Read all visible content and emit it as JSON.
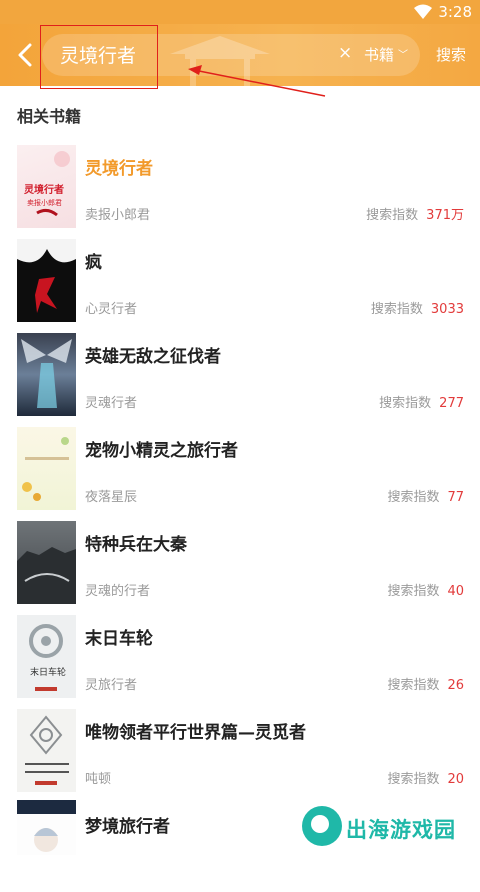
{
  "status_bar": {
    "time": "3:28"
  },
  "search": {
    "query": "灵境行者",
    "clear_label": "×",
    "category_label": "书籍",
    "search_button": "搜索"
  },
  "section_title": "相关书籍",
  "books": [
    {
      "title": "灵境行者",
      "author": "卖报小郎君",
      "score_label": "搜索指数",
      "score": "371万",
      "highlight": true,
      "cover_text": "灵境行者\n卖报小郎君"
    },
    {
      "title": "疯",
      "author": "心灵行者",
      "score_label": "搜索指数",
      "score": "3033"
    },
    {
      "title": "英雄无敌之征伐者",
      "author": "灵魂行者",
      "score_label": "搜索指数",
      "score": "277"
    },
    {
      "title": "宠物小精灵之旅行者",
      "author": "夜落星辰",
      "score_label": "搜索指数",
      "score": "77"
    },
    {
      "title": "特种兵在大秦",
      "author": "灵魂的行者",
      "score_label": "搜索指数",
      "score": "40"
    },
    {
      "title": "末日车轮",
      "author": "灵旅行者",
      "score_label": "搜索指数",
      "score": "26",
      "cover_text": "末日车轮"
    },
    {
      "title": "唯物领者平行世界篇—灵觅者",
      "author": "吨顿",
      "score_label": "搜索指数",
      "score": "20"
    },
    {
      "title": "梦境旅行者",
      "author": "",
      "score_label": "",
      "score": ""
    }
  ],
  "watermark": {
    "text": "出海游戏园"
  },
  "colors": {
    "accent": "#f29a2b",
    "topbar": "#f3a43a",
    "score_num": "#e23b3b",
    "annotation_red": "#e0201b"
  }
}
